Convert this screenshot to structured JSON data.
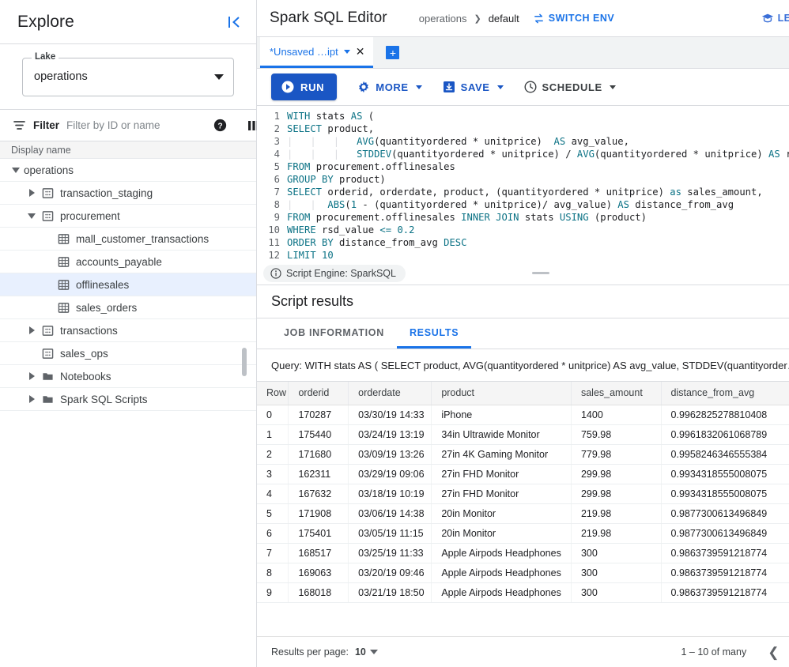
{
  "explore": {
    "title": "Explore",
    "collapse_icon": "collapse-left-icon",
    "lake": {
      "label": "Lake",
      "value": "operations"
    },
    "filter": {
      "label": "Filter",
      "placeholder": "Filter by ID or name",
      "help_icon": "help-icon",
      "columns_icon": "columns-icon"
    },
    "tree_header": "Display name",
    "tree": [
      {
        "label": "operations",
        "indent": 0,
        "arrow": "down",
        "icon": "none"
      },
      {
        "label": "transaction_staging",
        "indent": 1,
        "arrow": "right",
        "icon": "database"
      },
      {
        "label": "procurement",
        "indent": 1,
        "arrow": "down",
        "icon": "database"
      },
      {
        "label": "mall_customer_transactions",
        "indent": 2,
        "arrow": "none",
        "icon": "table"
      },
      {
        "label": "accounts_payable",
        "indent": 2,
        "arrow": "none",
        "icon": "table"
      },
      {
        "label": "offlinesales",
        "indent": 2,
        "arrow": "none",
        "icon": "table",
        "selected": true
      },
      {
        "label": "sales_orders",
        "indent": 2,
        "arrow": "none",
        "icon": "table"
      },
      {
        "label": "transactions",
        "indent": 1,
        "arrow": "right",
        "icon": "database"
      },
      {
        "label": "sales_ops",
        "indent": 1,
        "arrow": "none",
        "icon": "database"
      },
      {
        "label": "Notebooks",
        "indent": 1,
        "arrow": "right",
        "icon": "folder"
      },
      {
        "label": "Spark SQL Scripts",
        "indent": 1,
        "arrow": "right",
        "icon": "folder"
      }
    ]
  },
  "header": {
    "app_title": "Spark SQL Editor",
    "breadcrumb_root": "operations",
    "breadcrumb_current": "default",
    "switch_env": "SWITCH ENV",
    "switch_env_icon": "swap-icon",
    "learn": "LEARN",
    "learn_icon": "graduation-cap-icon"
  },
  "tabs": {
    "active_label": "*Unsaved …ipt",
    "close_icon": "close-icon",
    "add_icon": "add-tab-icon"
  },
  "toolbar": {
    "run": "RUN",
    "run_icon": "play-icon",
    "more": "MORE",
    "more_icon": "gear-icon",
    "save": "SAVE",
    "save_icon": "save-icon",
    "schedule": "SCHEDULE",
    "schedule_icon": "clock-icon",
    "info_icon": "info-icon"
  },
  "editor": {
    "lines": [
      {
        "n": "1",
        "html": "<span class='kw'>WITH</span> stats <span class='kw'>AS</span> ("
      },
      {
        "n": "2",
        "html": "<span class='kw'>SELECT</span> product,"
      },
      {
        "n": "3",
        "html": "<span class='ind'>|   |   |   </span><span class='fn'>AVG</span>(quantityordered * unitprice)  <span class='kw'>AS</span> avg_value,"
      },
      {
        "n": "4",
        "html": "<span class='ind'>|   |   |   </span><span class='fn'>STDDEV</span>(quantityordered * unitprice) / <span class='fn'>AVG</span>(quantityordered * unitprice) <span class='kw'>AS</span> rsd_v"
      },
      {
        "n": "5",
        "html": "<span class='kw'>FROM</span> procurement.offlinesales"
      },
      {
        "n": "6",
        "html": "<span class='kw'>GROUP BY</span> product)"
      },
      {
        "n": "7",
        "html": "<span class='kw'>SELECT</span> orderid, orderdate, product, (quantityordered * unitprice) <span class='kw'>as</span> sales_amount,"
      },
      {
        "n": "8",
        "html": "<span class='ind'>|   |  </span><span class='fn'>ABS</span>(<span class='num'>1</span> - (quantityordered * unitprice)/ avg_value) <span class='kw'>AS</span> distance_from_avg"
      },
      {
        "n": "9",
        "html": "<span class='kw'>FROM</span> procurement.offlinesales <span class='kw'>INNER JOIN</span> stats <span class='kw'>USING</span> (product)"
      },
      {
        "n": "10",
        "html": "<span class='kw'>WHERE</span> rsd_value <span class='kw'>&lt;=</span> <span class='num'>0.2</span>"
      },
      {
        "n": "11",
        "html": "<span class='kw'>ORDER BY</span> distance_from_avg <span class='kw'>DESC</span>"
      },
      {
        "n": "12",
        "html": "<span class='kw'>LIMIT</span> <span class='num'>10</span>"
      }
    ]
  },
  "engine": {
    "text": "Script Engine: SparkSQL",
    "icon": "info-outline-icon"
  },
  "results": {
    "title": "Script results",
    "tabs": [
      {
        "label": "JOB INFORMATION",
        "active": false
      },
      {
        "label": "RESULTS",
        "active": true
      }
    ],
    "query_selector": "Query: WITH stats AS ( SELECT product, AVG(quantityordered * unitprice) AS avg_value, STDDEV(quantityorder…",
    "columns": [
      "Row",
      "orderid",
      "orderdate",
      "product",
      "sales_amount",
      "distance_from_avg",
      ""
    ],
    "rows": [
      [
        "0",
        "170287",
        "03/30/19 14:33",
        "iPhone",
        "1400",
        "0.9962825278810408",
        ""
      ],
      [
        "1",
        "175440",
        "03/24/19 13:19",
        "34in Ultrawide Monitor",
        "759.98",
        "0.9961832061068789",
        ""
      ],
      [
        "2",
        "171680",
        "03/09/19 13:26",
        "27in 4K Gaming Monitor",
        "779.98",
        "0.9958246346555384",
        ""
      ],
      [
        "3",
        "162311",
        "03/29/19 09:06",
        "27in FHD Monitor",
        "299.98",
        "0.9934318555008075",
        ""
      ],
      [
        "4",
        "167632",
        "03/18/19 10:19",
        "27in FHD Monitor",
        "299.98",
        "0.9934318555008075",
        ""
      ],
      [
        "5",
        "171908",
        "03/06/19 14:38",
        "20in Monitor",
        "219.98",
        "0.9877300613496849",
        ""
      ],
      [
        "6",
        "175401",
        "03/05/19 11:15",
        "20in Monitor",
        "219.98",
        "0.9877300613496849",
        ""
      ],
      [
        "7",
        "168517",
        "03/25/19 11:33",
        "Apple Airpods Headphones",
        "300",
        "0.9863739591218774",
        ""
      ],
      [
        "8",
        "169063",
        "03/20/19 09:46",
        "Apple Airpods Headphones",
        "300",
        "0.9863739591218774",
        ""
      ],
      [
        "9",
        "168018",
        "03/21/19 18:50",
        "Apple Airpods Headphones",
        "300",
        "0.9863739591218774",
        ""
      ]
    ]
  },
  "pager": {
    "label": "Results per page:",
    "page_size": "10",
    "range": "1 – 10 of many",
    "prev_icon": "chevron-left-icon",
    "next_icon": "chevron-right-icon"
  },
  "colors": {
    "accent": "#1a73e8",
    "run": "#1a56c4",
    "selected_row": "#e8f0fe"
  }
}
